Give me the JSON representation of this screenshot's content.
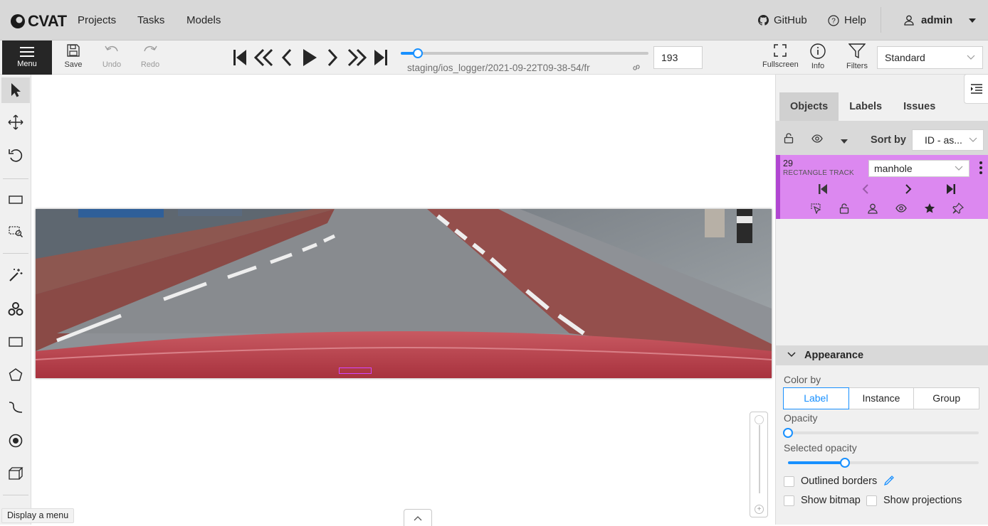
{
  "app": {
    "logo_text": "CVAT"
  },
  "header": {
    "nav": [
      "Projects",
      "Tasks",
      "Models"
    ],
    "github_label": "GitHub",
    "help_label": "Help",
    "user_name": "admin"
  },
  "toolbar": {
    "menu_label": "Menu",
    "save_label": "Save",
    "undo_label": "Undo",
    "redo_label": "Redo",
    "frame_filename": "staging/ios_logger/2021-09-22T09-38-54/fr",
    "frame_number": "193",
    "frame_progress": 0.07,
    "fullscreen_label": "Fullscreen",
    "info_label": "Info",
    "filters_label": "Filters",
    "workspace": "Standard"
  },
  "left_controls": [
    "cursor",
    "move",
    "rotate",
    "fit-image",
    "zoom-region",
    "magic-wand",
    "openvino",
    "rectangle",
    "polygon",
    "polyline",
    "points",
    "cuboid"
  ],
  "canvas": {
    "tooltip": "Display a menu"
  },
  "sidebar": {
    "tabs": [
      "Objects",
      "Labels",
      "Issues"
    ],
    "sort_by_label": "Sort by",
    "sort_value": "ID - as...",
    "object": {
      "id": "29",
      "type": "RECTANGLE TRACK",
      "label": "manhole",
      "color": "#dc88f0"
    },
    "appearance": {
      "title": "Appearance",
      "color_by_label": "Color by",
      "color_by_options": [
        "Label",
        "Instance",
        "Group"
      ],
      "color_by_selected": "Label",
      "opacity_label": "Opacity",
      "opacity_value": 0.0,
      "selected_opacity_label": "Selected opacity",
      "selected_opacity_value": 0.3,
      "outlined_borders_label": "Outlined borders",
      "show_bitmap_label": "Show bitmap",
      "show_projections_label": "Show projections"
    }
  }
}
